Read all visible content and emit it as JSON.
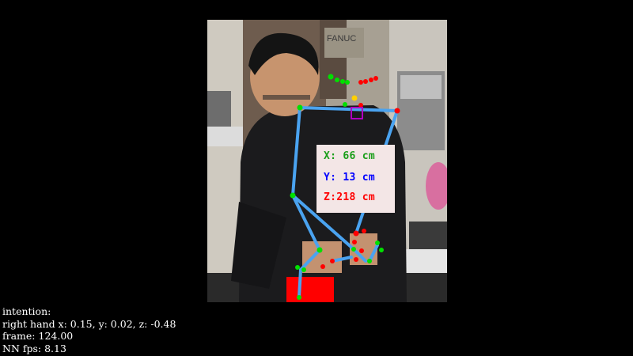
{
  "colors": {
    "background": "#000000",
    "skeleton": "#4aa3f0",
    "keypoint_left": "#00e000",
    "keypoint_right": "#ff0000",
    "marker": "#ffd000",
    "target_box": "#b000c0",
    "x_text": "#1a9e1a",
    "y_text": "#0000ff",
    "z_text": "#ff0000",
    "coord_box_bg": "#f3e6e6",
    "readout_text": "#ffffff"
  },
  "camera": {
    "background_sign": "FANUC"
  },
  "coords": {
    "x_label": "X: 66 cm",
    "y_label": "Y: 13 cm",
    "z_label": "Z:218 cm"
  },
  "readout": {
    "intention": "intention:",
    "right_hand": "right hand x: 0.15, y: 0.02, z: -0.48",
    "frame": "frame: 124.00",
    "nn_fps": "NN fps: 8.13"
  }
}
